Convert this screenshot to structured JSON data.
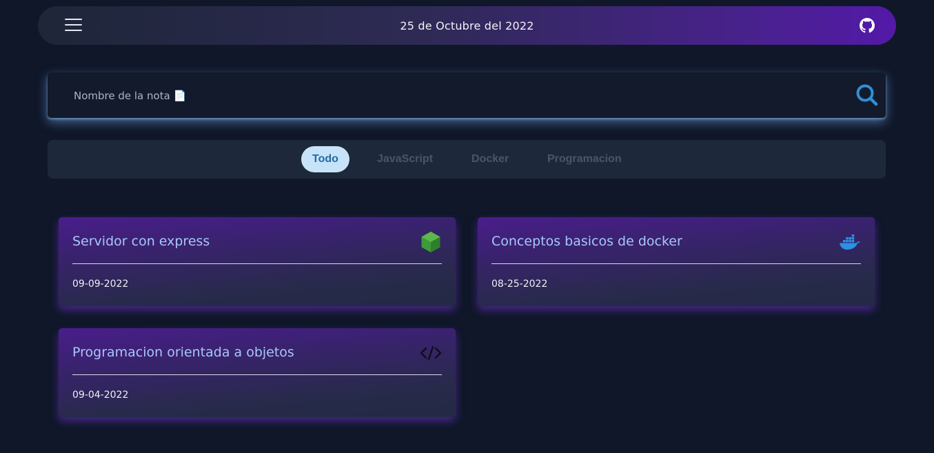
{
  "header": {
    "date": "25 de Octubre del 2022",
    "menu_icon": "hamburger-menu-icon",
    "github_icon": "github-icon"
  },
  "search": {
    "placeholder": "Nombre de la nota 📄",
    "value": "",
    "icon": "search-icon"
  },
  "tabs": [
    {
      "label": "Todo",
      "active": true
    },
    {
      "label": "JavaScript",
      "active": false
    },
    {
      "label": "Docker",
      "active": false
    },
    {
      "label": "Programacion",
      "active": false
    }
  ],
  "notes": [
    {
      "title": "Servidor con express",
      "date": "09-09-2022",
      "icon": "nodejs-icon"
    },
    {
      "title": "Conceptos basicos de docker",
      "date": "08-25-2022",
      "icon": "docker-icon"
    },
    {
      "title": "Programacion orientada a objetos",
      "date": "09-04-2022",
      "icon": "code-icon"
    }
  ],
  "colors": {
    "background": "#0f1729",
    "accent_purple": "#5319a8",
    "tab_active_bg": "#c7e3f7",
    "tab_active_text": "#1f6ba6",
    "note_title": "#a7c8f5",
    "search_icon": "#2f8fd6"
  }
}
